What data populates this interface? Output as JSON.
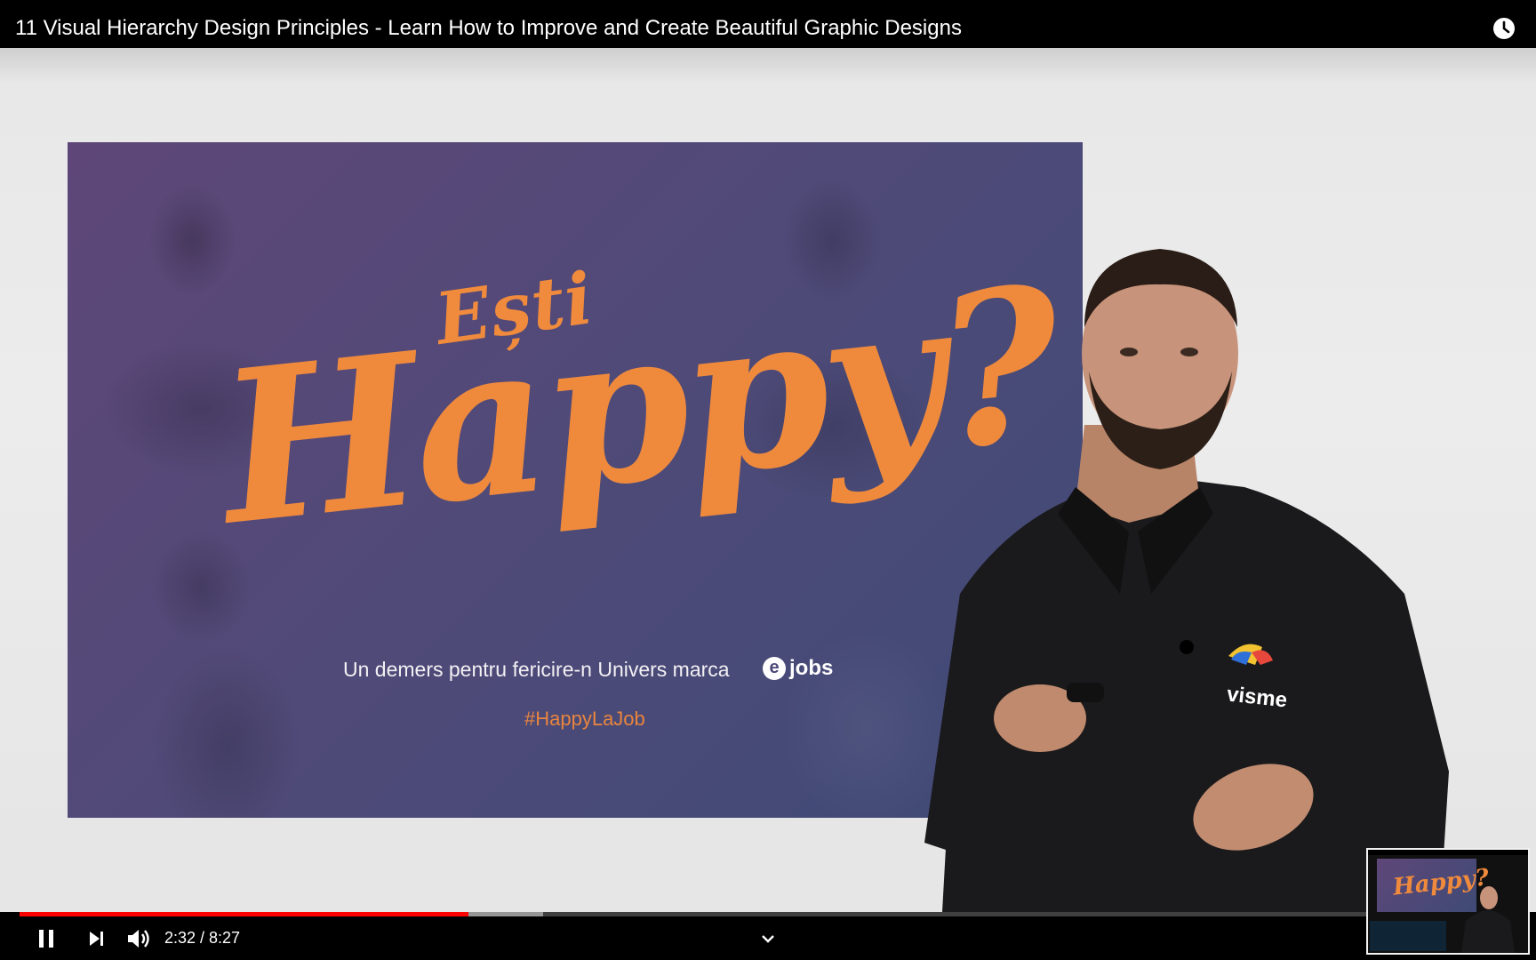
{
  "video": {
    "title": "11 Visual Hierarchy Design Principles - Learn How to Improve and Create Beautiful Graphic Designs",
    "current_time": "2:32",
    "duration": "8:27",
    "time_display": "2:32 / 8:27",
    "progress_fraction": 0.3,
    "buffered_fraction": 0.35
  },
  "slide": {
    "line1": "Ești",
    "line2": "Happy?",
    "tagline": "Un demers pentru fericire-n Univers marca",
    "logo_mark": "e",
    "logo_text": "jobs",
    "hashtag": "#HappyLaJob"
  },
  "shirt_logo": "visme",
  "icons": {
    "watch_later": "clock-icon",
    "pause": "pause-icon",
    "next": "next-icon",
    "volume": "volume-icon",
    "expand": "chevron-down-icon"
  },
  "colors": {
    "progress": "#ff0000",
    "accent_orange": "#ef8a3d",
    "slide_purple": "#5e4778"
  }
}
